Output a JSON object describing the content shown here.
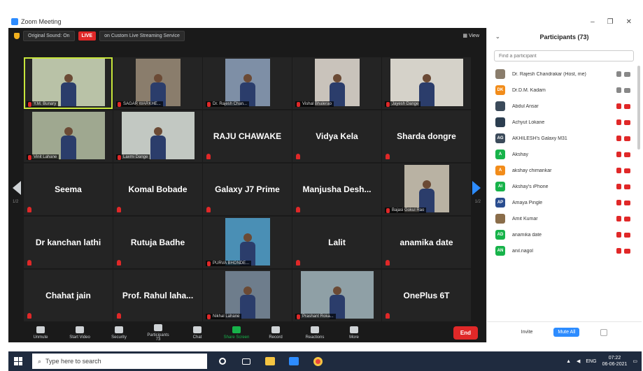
{
  "window": {
    "title": "Zoom Meeting",
    "controls": [
      "–",
      "❐",
      "✕"
    ]
  },
  "topbar": {
    "sound_label": "Original Sound: On",
    "live_badge": "LIVE",
    "stream_label": "on Custom Live Streaming Service",
    "view_label": "View"
  },
  "tiles": [
    {
      "name": "",
      "tag": "Y.M. Bunary",
      "video": true,
      "active": true,
      "bg": "#b9c2a7"
    },
    {
      "name": "",
      "tag": "SAGAR WARKHE...",
      "video": true,
      "bg": "#8a7d6c"
    },
    {
      "name": "",
      "tag": "Dr. Rajesh Chan...",
      "video": true,
      "bg": "#7e8fa6"
    },
    {
      "name": "",
      "tag": "Vishal Bhalerao",
      "video": true,
      "bg": "#c9c3bb"
    },
    {
      "name": "",
      "tag": "Jayesh Dange",
      "video": true,
      "bg": "#d5d2c9"
    },
    {
      "name": "",
      "tag": "Vinit Lahane",
      "video": true,
      "bg": "#9fa890"
    },
    {
      "name": "",
      "tag": "Laxmi Dange",
      "video": true,
      "bg": "#c2c8c2"
    },
    {
      "name": "RAJU CHAWAKE",
      "tag": "",
      "video": false
    },
    {
      "name": "Vidya Kela",
      "tag": "",
      "video": false
    },
    {
      "name": "Sharda dongre",
      "tag": "",
      "video": false
    },
    {
      "name": "Seema",
      "tag": "",
      "video": false
    },
    {
      "name": "Komal Bobade",
      "tag": "",
      "video": false
    },
    {
      "name": "Galaxy J7 Prime",
      "tag": "",
      "video": false
    },
    {
      "name": "Manjusha Desh...",
      "tag": "",
      "video": false
    },
    {
      "name": "",
      "tag": "Bajasi Gokul Rao",
      "video": true,
      "bg": "#b9b2a3"
    },
    {
      "name": "Dr kanchan lathi",
      "tag": "",
      "video": false
    },
    {
      "name": "Rutuja Badhe",
      "tag": "",
      "video": false
    },
    {
      "name": "",
      "tag": "PURVA BHONDE...",
      "video": true,
      "bg": "#4a8fb5"
    },
    {
      "name": "Lalit",
      "tag": "",
      "video": false
    },
    {
      "name": "anamika date",
      "tag": "",
      "video": false
    },
    {
      "name": "Chahat jain",
      "tag": "",
      "video": false
    },
    {
      "name": "Prof. Rahul laha...",
      "tag": "",
      "video": false
    },
    {
      "name": "",
      "tag": "Nikhal Lahane",
      "video": true,
      "bg": "#6e7d8c"
    },
    {
      "name": "",
      "tag": "Prashant Roka...",
      "video": true,
      "bg": "#8fa0a6"
    },
    {
      "name": "OnePlus 6T",
      "tag": "",
      "video": false
    }
  ],
  "pager": {
    "left": "1/2",
    "right": "1/2"
  },
  "toolbar": [
    {
      "label": "Unmute",
      "key": "unmute"
    },
    {
      "label": "Start Video",
      "key": "video"
    },
    {
      "label": "Security",
      "key": "security"
    },
    {
      "label": "Participants",
      "key": "participants",
      "count": "73"
    },
    {
      "label": "Chat",
      "key": "chat"
    },
    {
      "label": "Share Screen",
      "key": "share"
    },
    {
      "label": "Record",
      "key": "record"
    },
    {
      "label": "Reactions",
      "key": "reactions"
    },
    {
      "label": "More",
      "key": "more"
    }
  ],
  "end_label": "End",
  "panel": {
    "title": "Participants (73)",
    "search_placeholder": "Find a participant",
    "participants": [
      {
        "name": "Dr. Rajesh Chandrakar (Host, me)",
        "initials": "",
        "color": "#8a7d6c",
        "muted": false
      },
      {
        "name": "Dr.D.M. Kadam",
        "initials": "DK",
        "color": "#f28c1a",
        "muted": false
      },
      {
        "name": "Abdul Ansar",
        "initials": "",
        "color": "#3b4a5a",
        "muted": true
      },
      {
        "name": "Achyut Lokane",
        "initials": "",
        "color": "#2c3e50",
        "muted": true
      },
      {
        "name": "AKHILESH's Galaxy M31",
        "initials": "AG",
        "color": "#3b4a5a",
        "muted": true
      },
      {
        "name": "Akshay",
        "initials": "A",
        "color": "#17b34a",
        "muted": true
      },
      {
        "name": "akshay chimankar",
        "initials": "A",
        "color": "#f28c1a",
        "muted": true
      },
      {
        "name": "Akshay's iPhone",
        "initials": "AI",
        "color": "#17b34a",
        "muted": true
      },
      {
        "name": "Amaya Pingle",
        "initials": "AP",
        "color": "#2a4d8f",
        "muted": true
      },
      {
        "name": "Amit Kumar",
        "initials": "",
        "color": "#8a6d4a",
        "muted": true
      },
      {
        "name": "anamika date",
        "initials": "AD",
        "color": "#17b34a",
        "muted": true
      },
      {
        "name": "anil.nagol",
        "initials": "AN",
        "color": "#17b34a",
        "muted": true
      }
    ],
    "invite_label": "Invite",
    "mute_all_label": "Mute All"
  },
  "taskbar": {
    "search_placeholder": "Type here to search",
    "lang": "ENG",
    "time": "07:22",
    "date": "06-06-2021"
  }
}
